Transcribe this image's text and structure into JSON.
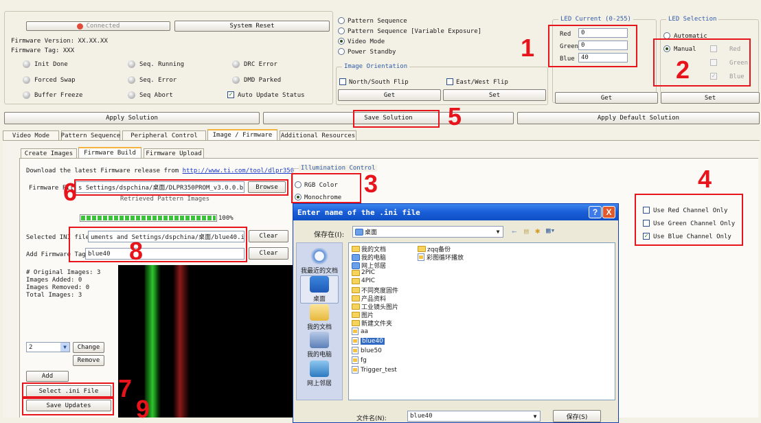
{
  "status": {
    "connected_label": "Connected",
    "firmware_version": "Firmware Version: XX.XX.XX",
    "firmware_tag": "Firmware Tag: XXX",
    "system_reset": "System Reset",
    "indicators": {
      "init_done": "Init Done",
      "seq_running": "Seq. Running",
      "drc_error": "DRC Error",
      "forced_swap": "Forced Swap",
      "seq_error": "Seq. Error",
      "dmd_parked": "DMD Parked",
      "buffer_freeze": "Buffer Freeze",
      "seq_abort": "Seq Abort"
    },
    "auto_update": "Auto Update Status"
  },
  "mode": {
    "pattern_sequence": "Pattern Sequence",
    "pattern_sequence_var": "Pattern Sequence [Variable Exposure]",
    "video_mode": "Video Mode",
    "power_standby": "Power Standby",
    "selected": "Video Mode"
  },
  "orientation": {
    "title": "Image Orientation",
    "ns_flip": "North/South Flip",
    "ew_flip": "East/West Flip",
    "get": "Get",
    "set": "Set"
  },
  "led_current": {
    "title": "LED Current (0-255)",
    "red_label": "Red",
    "red_value": "0",
    "green_label": "Green",
    "green_value": "0",
    "blue_label": "Blue",
    "blue_value": "40",
    "get": "Get"
  },
  "led_selection": {
    "title": "LED Selection",
    "automatic": "Automatic",
    "manual": "Manual",
    "red": "Red",
    "green": "Green",
    "blue": "Blue",
    "set": "Set"
  },
  "solution": {
    "apply": "Apply Solution",
    "save": "Save Solution",
    "apply_default": "Apply Default Solution"
  },
  "tabs": [
    "Video Mode",
    "Pattern Sequence",
    "Peripheral Control",
    "Image / Firmware",
    "Additional Resources"
  ],
  "subtabs": [
    "Create Images",
    "Firmware Build",
    "Firmware Upload"
  ],
  "firmware": {
    "download_prefix": "Download the latest Firmware release from",
    "download_url": "http://www.ti.com/tool/dlpr350",
    "file_label": "Firmware Fil",
    "file_value": "s Settings/dspchina/桌面/DLPR350PROM_v3.0.0.bin",
    "browse": "Browse",
    "retrieved": "Retrieved Pattern Images",
    "progress_label": "100%",
    "progress_value": 1.0,
    "ini_label": "Selected INI file",
    "ini_value": "uments and Settings/dspchina/桌面/blue40.ini",
    "clear": "Clear",
    "tag_label": "Add Firmware Tag",
    "tag_value": "blue40",
    "stats": [
      "# Original Images: 3",
      "Images Added: 0",
      "Images Removed: 0",
      "Total Images: 3"
    ],
    "index_value": "2",
    "change": "Change",
    "remove": "Remove",
    "add": "Add",
    "select_ini": "Select .ini File",
    "save_updates": "Save Updates"
  },
  "illumination": {
    "title": "Illumination Control",
    "rgb": "RGB Color",
    "mono": "Monochrome"
  },
  "channels": {
    "red": "Use Red Channel Only",
    "green": "Use Green Channel Only",
    "blue": "Use Blue Channel Only"
  },
  "dialog": {
    "title": "Enter name of the .ini file",
    "help": "?",
    "close": "X",
    "save_in_label": "保存在(I):",
    "save_in_value": "桌面",
    "places": [
      "我最近的文档",
      "桌面",
      "我的文档",
      "我的电脑",
      "网上邻居"
    ],
    "files_col1": [
      "我的文档",
      "我的电脑",
      "网上邻居",
      "2PIC",
      "4PIC",
      "不同亮度固件",
      "产品资料",
      "工业镜头图片",
      "图片",
      "新建文件夹",
      "aa",
      "blue40",
      "blue50",
      "fg",
      "Trigger_test"
    ],
    "files_col2": [
      "zqq备份",
      "彩图循环播放"
    ],
    "filename_label": "文件名(N):",
    "filename_value": "blue40",
    "save_button": "保存(S)"
  },
  "annotations": [
    "1",
    "2",
    "3",
    "4",
    "5",
    "6",
    "7",
    "8",
    "9"
  ],
  "colors": {
    "annotation": "#e8141b",
    "background": "#f3f0e6",
    "dialog_title": "#1a5ed8"
  }
}
